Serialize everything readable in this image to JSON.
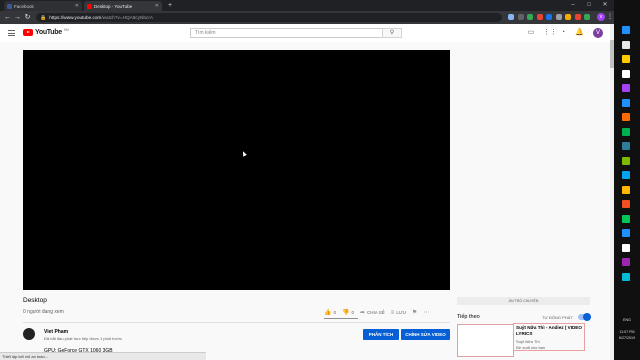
{
  "browser": {
    "tabs": [
      {
        "title": "Facebook",
        "favicon_color": "#3b5998",
        "active": false
      },
      {
        "title": "Desktop - YouTube",
        "favicon_color": "#ff0000",
        "active": true
      }
    ],
    "new_tab": "+",
    "window_controls": [
      "–",
      "□",
      "✕"
    ],
    "url_host": "https://www.youtube.com",
    "url_path": "/watch?v=HQA8cyNbcrA",
    "profile_initial": "v",
    "extension_colors": [
      "#8ab4f8",
      "#5f6368",
      "#34a853",
      "#ea4335",
      "#1a73e8",
      "#9aa0a6",
      "#f9ab00",
      "#ea4335",
      "#34a853"
    ]
  },
  "youtube": {
    "logo_word": "YouTube",
    "logo_country": "VN",
    "search_placeholder": "Tìm kiếm",
    "avatar_initial": "V"
  },
  "video": {
    "title": "Desktop",
    "views": "0 người đang xem",
    "likes": "0",
    "dislikes": "0",
    "share_label": "CHIA SẺ",
    "save_label": "LƯU"
  },
  "channel": {
    "name": "Viet Pham",
    "subtitle": "Đã bắt đầu phát trực tiếp được 1 phút trước",
    "description": "GPU: GeForce GTX 1060 3GB",
    "analytics_button": "PHÂN TÍCH",
    "edit_button": "CHỈNH SỬA VIDEO"
  },
  "sidebar": {
    "chat_bar": "ẨN TRÒ CHUYỆN",
    "up_next": "Tiếp theo",
    "autoplay": "TỰ ĐỘNG PHÁT",
    "next_title": "Suýt Nữa Thì - Andiez ( VIDEO LYRICS",
    "next_channel": "Suýt Nữa Thì",
    "next_meta": "Đề xuất cho bạn"
  },
  "status_bar": "Thiết lập kết nối an toàn...",
  "taskbar": {
    "language": "ENG",
    "time": "11:07 PM",
    "date": "6/27/2019",
    "icon_colors": [
      "#1e90ff",
      "#e8e8e8",
      "#ffcc00",
      "#ffffff",
      "#a142f4",
      "#1e90ff",
      "#ff6a00",
      "#00b050",
      "#2d7d9a",
      "#7fba00",
      "#00a4ef",
      "#ffb900",
      "#f25022",
      "#00c853",
      "#1e90ff",
      "#ffffff",
      "#9c27b0",
      "#00bcd4"
    ]
  }
}
